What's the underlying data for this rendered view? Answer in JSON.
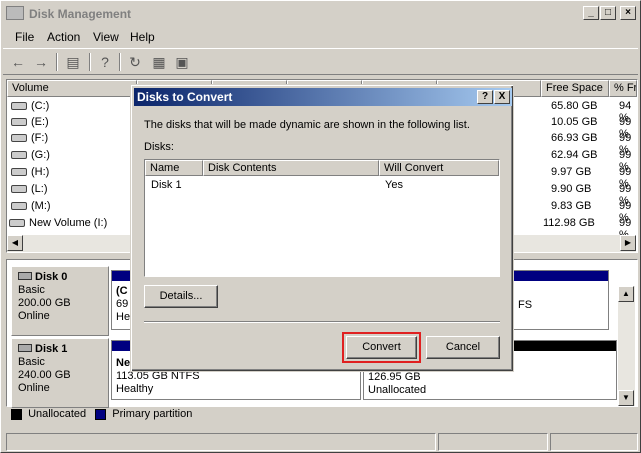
{
  "window": {
    "title": "Disk Management"
  },
  "menu": {
    "items": [
      "File",
      "Action",
      "View",
      "Help"
    ]
  },
  "toolbar": {
    "icons": [
      "back-arrow-icon",
      "forward-arrow-icon",
      "console-tree-icon",
      "help-icon",
      "refresh-icon",
      "properties-icon",
      "rescan-icon"
    ]
  },
  "volume_list": {
    "columns": [
      "Volume",
      "Free Space",
      "% Fr"
    ],
    "rows": [
      {
        "volume": "(C:)",
        "free": "65.80 GB",
        "pct": "94 %"
      },
      {
        "volume": "(E:)",
        "free": "10.05 GB",
        "pct": "99 %"
      },
      {
        "volume": "(F:)",
        "free": "66.93 GB",
        "pct": "99 %"
      },
      {
        "volume": "(G:)",
        "free": "62.94 GB",
        "pct": "99 %"
      },
      {
        "volume": "(H:)",
        "free": "9.97 GB",
        "pct": "99 %"
      },
      {
        "volume": "(L:)",
        "free": "9.90 GB",
        "pct": "99 %"
      },
      {
        "volume": "(M:)",
        "free": "9.83 GB",
        "pct": "99 %"
      },
      {
        "volume": "New Volume (I:)",
        "free": "112.98 GB",
        "pct": "99 %"
      }
    ]
  },
  "disks": [
    {
      "name": "Disk 0",
      "type": "Basic",
      "size": "200.00 GB",
      "status": "Online",
      "part1": {
        "l1": "(C",
        "l2": "69",
        "l3": "He"
      },
      "part2": {
        "l1": "FS"
      }
    },
    {
      "name": "Disk 1",
      "type": "Basic",
      "size": "240.00 GB",
      "status": "Online",
      "part1": {
        "l1": "Ne",
        "l2": "113.05 GB NTFS",
        "l3": "Healthy"
      },
      "part2": {
        "l1": "126.95 GB",
        "l2": "Unallocated"
      }
    }
  ],
  "legend": {
    "unallocated": "Unallocated",
    "primary": "Primary partition",
    "unallocated_color": "#000000",
    "primary_color": "#000080"
  },
  "dialog": {
    "title": "Disks to Convert",
    "help_btn": "?",
    "close_btn": "X",
    "description": "The disks that will be made dynamic are shown in the following list.",
    "disks_label": "Disks:",
    "columns": [
      "Name",
      "Disk Contents",
      "Will Convert"
    ],
    "rows": [
      {
        "name": "Disk 1",
        "contents": "",
        "convert": "Yes"
      }
    ],
    "details_button": "Details...",
    "convert_button": "Convert",
    "cancel_button": "Cancel",
    "highlight_color": "#e02020"
  }
}
